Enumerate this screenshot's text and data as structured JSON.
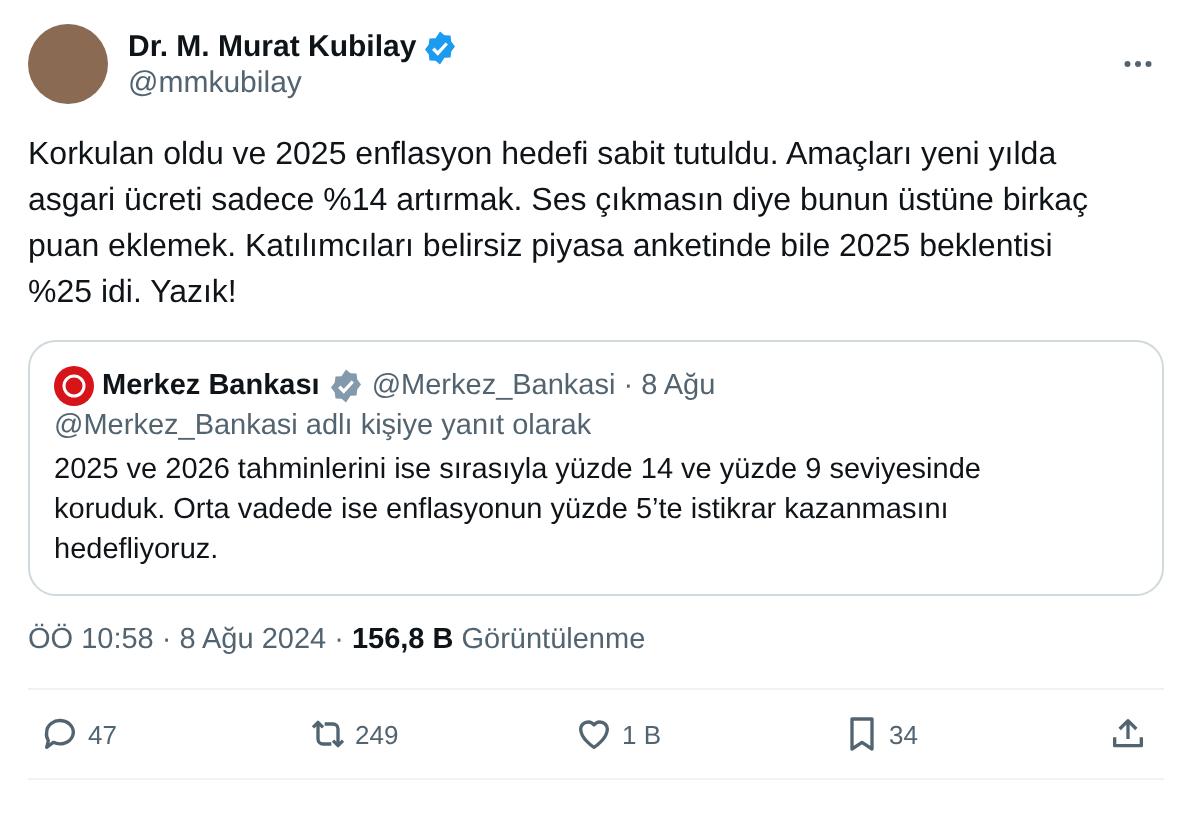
{
  "author": {
    "name": "Dr. M. Murat Kubilay",
    "verified": true,
    "handle": "@mmkubilay"
  },
  "text": "Korkulan oldu ve 2025 enflasyon hedefi sabit tutuldu. Amaçları yeni yılda asgari ücreti sadece %14 artırmak. Ses çıkmasın diye bunun üstüne birkaç puan eklemek. Katılımcıları belirsiz piyasa anketinde bile 2025 beklentisi %25 idi. Yazık!",
  "quote": {
    "name": "Merkez Bankası",
    "verified": true,
    "handle": "@Merkez_Bankasi",
    "separator": "·",
    "date": "8 Ağu",
    "reply_to": "@Merkez_Bankasi adlı kişiye yanıt olarak",
    "text": "2025 ve 2026 tahminlerini ise sırasıyla yüzde 14 ve yüzde 9 seviyesinde koruduk. Orta vadede ise enflasyonun yüzde 5’te istikrar kazanmasını hedefliyoruz."
  },
  "meta": {
    "time": "ÖÖ 10:58",
    "separator_1": "·",
    "date": "8 Ağu 2024",
    "separator_2": "·",
    "views": "156,8 B",
    "views_label": "Görüntülenme"
  },
  "actions": [
    {
      "kind": "reply",
      "count": "47"
    },
    {
      "kind": "repost",
      "count": "249"
    },
    {
      "kind": "like",
      "count": "1 B"
    },
    {
      "kind": "bookmark",
      "count": "34"
    },
    {
      "kind": "share"
    }
  ]
}
